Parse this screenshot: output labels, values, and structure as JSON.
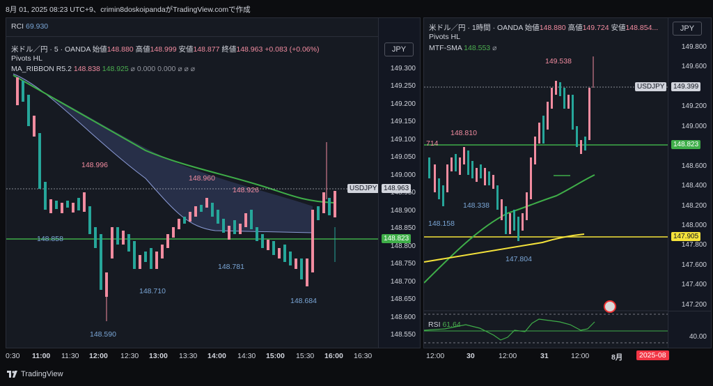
{
  "header": {
    "text": "8月 01, 2025 08:23 UTC+9、crimin8doskoipandaがTradingView.comで作成"
  },
  "left_chart": {
    "rci_label": "RCI",
    "rci_value": "69.930",
    "symbol": "米ドル／円 · 5 · OANDA",
    "open_label": "始値",
    "open": "148.880",
    "high_label": "高値",
    "high": "148.999",
    "low_label": "安値",
    "low": "148.877",
    "close_label": "終値",
    "close": "148.963",
    "change": "+0.083 (+0.06%)",
    "pivots_label": "Pivots HL",
    "ribbon_label": "MA_RIBBON R5.2",
    "ribbon_v1": "148.838",
    "ribbon_v2": "148.925",
    "ribbon_v3": "0.000",
    "ribbon_v4": "0.000",
    "currency": "JPY",
    "price_ticks": [
      "149.300",
      "149.250",
      "149.200",
      "149.150",
      "149.100",
      "149.050",
      "149.000",
      "148.950",
      "148.900",
      "148.850",
      "148.800",
      "148.750",
      "148.700",
      "148.650",
      "148.600",
      "148.550"
    ],
    "time_ticks": [
      "0:30",
      "11:00",
      "11:30",
      "12:00",
      "12:30",
      "13:00",
      "13:30",
      "14:00",
      "14:30",
      "15:00",
      "15:30",
      "16:00",
      "16:30"
    ],
    "symbol_tag": "USDJPY",
    "price_tag": "148.963",
    "line_tag": "148.823",
    "pivots": [
      "148.996",
      "148.960",
      "148.926",
      "148.858",
      "148.781",
      "148.710",
      "148.684",
      "148.590"
    ]
  },
  "right_chart": {
    "symbol": "米ドル／円 · 1時間 · OANDA",
    "open_label": "始値",
    "open": "148.880",
    "high_label": "高値",
    "high": "149.724",
    "low_label": "安値",
    "low": "148.854...",
    "pivots_label": "Pivots HL",
    "sma_label": "MTF-SMA",
    "sma_value": "148.553",
    "currency": "JPY",
    "price_ticks": [
      "149.800",
      "149.600",
      "149.400",
      "149.200",
      "149.000",
      "148.800",
      "148.600",
      "148.400",
      "148.200",
      "148.000",
      "147.800",
      "147.600",
      "147.400",
      "147.200"
    ],
    "rsi_tick": "40.00",
    "time_ticks": [
      "12:00",
      "30",
      "12:00",
      "31",
      "12:00",
      "8月"
    ],
    "date_tag": "2025-08",
    "symbol_tag": "USDJPY",
    "price_tag": "149.399",
    "green_tag": "148.823",
    "yellow_tag": "147.905",
    "rsi_label": "RSI",
    "rsi_value": "61.64",
    "pivots": [
      "149.538",
      "148.810",
      "714",
      "148.338",
      "148.158",
      "147.804"
    ]
  },
  "footer": {
    "brand": "TradingView"
  },
  "colors": {
    "up": "#f28ca0",
    "down": "#26a69a",
    "ma_green": "#3fae49",
    "yellow": "#f5e33b",
    "ribbon": "#7d8fc7"
  }
}
